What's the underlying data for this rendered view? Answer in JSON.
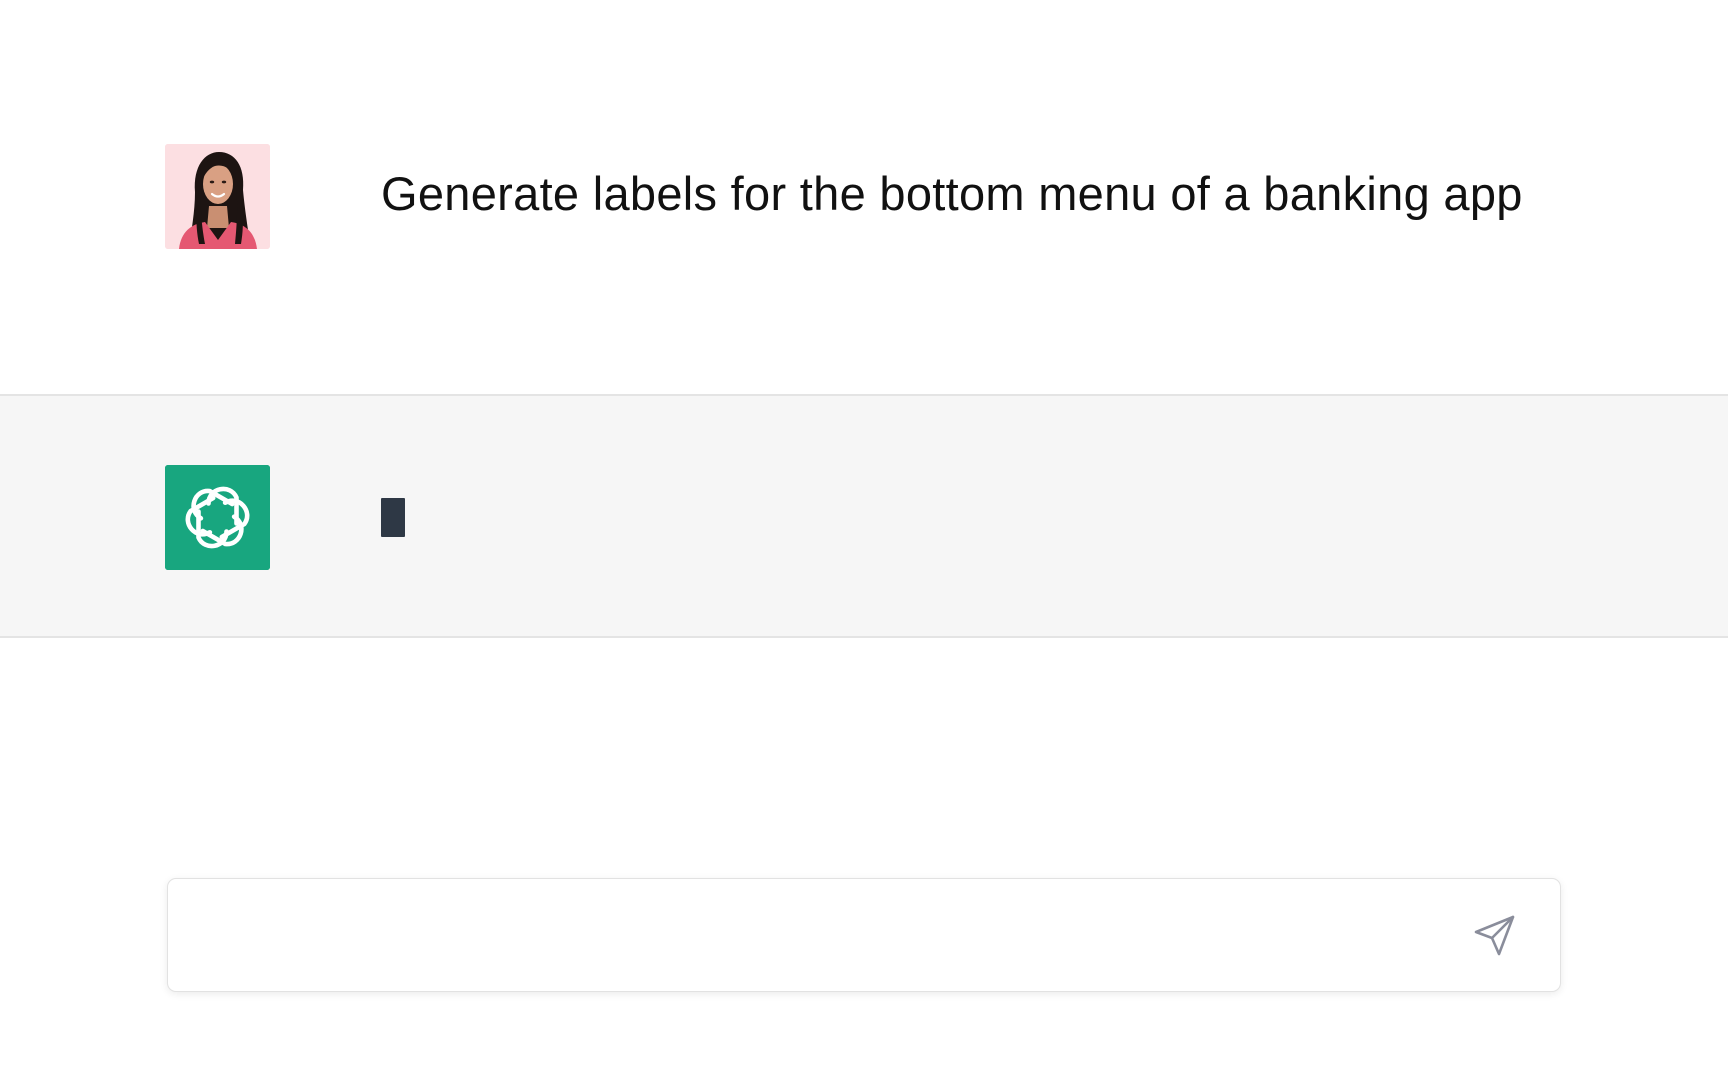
{
  "conversation": {
    "user_message": {
      "text": "Generate labels for the bottom menu of a banking app",
      "avatar_icon": "user-portrait-avatar"
    },
    "assistant_message": {
      "avatar_icon": "openai-logo-icon",
      "state": "typing-cursor"
    }
  },
  "composer": {
    "value": "",
    "placeholder": "",
    "send_icon": "send-icon"
  },
  "colors": {
    "assistant_brand": "#18a67f",
    "assistant_row_bg": "#f6f6f6",
    "cursor": "#2e3845",
    "send_icon": "#8a8d9b"
  }
}
